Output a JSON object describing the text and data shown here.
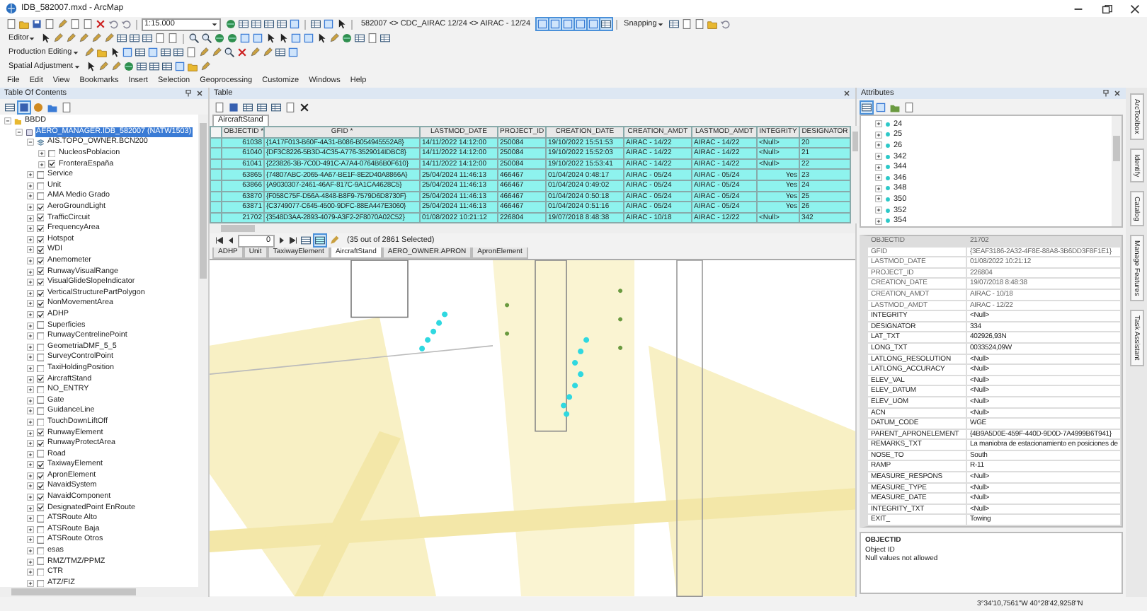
{
  "window": {
    "title": "IDB_582007.mxd - ArcMap"
  },
  "toolbars": {
    "scale": "1:15.000",
    "version_text": "582007 <> CDC_AIRAC 12/24 <> AIRAC - 12/24",
    "snapping": "Snapping",
    "editor": "Editor",
    "production_editing": "Production Editing",
    "spatial_adjustment": "Spatial Adjustment"
  },
  "menu": [
    "File",
    "Edit",
    "View",
    "Bookmarks",
    "Insert",
    "Selection",
    "Geoprocessing",
    "Customize",
    "Windows",
    "Help"
  ],
  "toc": {
    "title": "Table Of Contents",
    "tree": [
      {
        "label": "BBDD",
        "kind": "database",
        "expanded": true,
        "selected": false,
        "children": [
          {
            "label": "AERO_MANAGER.IDB_582007 (NATW1503)",
            "kind": "connection",
            "expanded": true,
            "selected": true,
            "children": [
              {
                "label": "AIS.TOPO_OWNER.BCN200",
                "kind": "group",
                "expanded": true,
                "selected": false,
                "children": [
                  {
                    "label": "NucleosPoblacion",
                    "kind": "layer",
                    "expanded": false,
                    "checked": false,
                    "selected": false
                  },
                  {
                    "label": "FronteraEspaña",
                    "kind": "layer",
                    "expanded": false,
                    "checked": true,
                    "selected": false
                  }
                ]
              },
              {
                "label": "Service",
                "kind": "layer",
                "expanded": false,
                "checked": false,
                "selected": false
              },
              {
                "label": "Unit",
                "kind": "layer",
                "expanded": false,
                "checked": false,
                "selected": false
              },
              {
                "label": "AMA Medio Grado",
                "kind": "layer",
                "expanded": false,
                "checked": false,
                "selected": false
              },
              {
                "label": "AeroGroundLight",
                "kind": "layer",
                "expanded": false,
                "checked": true,
                "selected": false
              },
              {
                "label": "TrafficCircuit",
                "kind": "layer",
                "expanded": false,
                "checked": true,
                "selected": false
              },
              {
                "label": "FrequencyArea",
                "kind": "layer",
                "expanded": false,
                "checked": true,
                "selected": false
              },
              {
                "label": "Hotspot",
                "kind": "layer",
                "expanded": false,
                "checked": true,
                "selected": false
              },
              {
                "label": "WDI",
                "kind": "layer",
                "expanded": false,
                "checked": true,
                "selected": false
              },
              {
                "label": "Anemometer",
                "kind": "layer",
                "expanded": false,
                "checked": true,
                "selected": false
              },
              {
                "label": "RunwayVisualRange",
                "kind": "layer",
                "expanded": false,
                "checked": true,
                "selected": false
              },
              {
                "label": "VisualGlideSlopeIndicator",
                "kind": "layer",
                "expanded": false,
                "checked": true,
                "selected": false
              },
              {
                "label": "VerticalStructurePartPolygon",
                "kind": "layer",
                "expanded": false,
                "checked": true,
                "selected": false
              },
              {
                "label": "NonMovementArea",
                "kind": "layer",
                "expanded": false,
                "checked": true,
                "selected": false
              },
              {
                "label": "ADHP",
                "kind": "layer",
                "expanded": false,
                "checked": true,
                "selected": false
              },
              {
                "label": "Superficies",
                "kind": "layer",
                "expanded": false,
                "checked": false,
                "selected": false
              },
              {
                "label": "RunwayCentrelinePoint",
                "kind": "layer",
                "expanded": false,
                "checked": false,
                "selected": false
              },
              {
                "label": "GeometriaDMF_5_5",
                "kind": "layer",
                "expanded": false,
                "checked": false,
                "selected": false
              },
              {
                "label": "SurveyControlPoint",
                "kind": "layer",
                "expanded": false,
                "checked": false,
                "selected": false
              },
              {
                "label": "TaxiHoldingPosition",
                "kind": "layer",
                "expanded": false,
                "checked": false,
                "selected": false
              },
              {
                "label": "AircraftStand",
                "kind": "layer",
                "expanded": false,
                "checked": true,
                "selected": false
              },
              {
                "label": "NO_ENTRY",
                "kind": "layer",
                "expanded": false,
                "checked": false,
                "selected": false
              },
              {
                "label": "Gate",
                "kind": "layer",
                "expanded": false,
                "checked": false,
                "selected": false
              },
              {
                "label": "GuidanceLine",
                "kind": "layer",
                "expanded": false,
                "checked": false,
                "selected": false
              },
              {
                "label": "TouchDownLiftOff",
                "kind": "layer",
                "expanded": false,
                "checked": false,
                "selected": false
              },
              {
                "label": "RunwayElement",
                "kind": "layer",
                "expanded": false,
                "checked": true,
                "selected": false
              },
              {
                "label": "RunwayProtectArea",
                "kind": "layer",
                "expanded": false,
                "checked": true,
                "selected": false
              },
              {
                "label": "Road",
                "kind": "layer",
                "expanded": false,
                "checked": false,
                "selected": false
              },
              {
                "label": "TaxiwayElement",
                "kind": "layer",
                "expanded": false,
                "checked": true,
                "selected": false
              },
              {
                "label": "ApronElement",
                "kind": "layer",
                "expanded": false,
                "checked": true,
                "selected": false
              },
              {
                "label": "NavaidSystem",
                "kind": "layer",
                "expanded": false,
                "checked": true,
                "selected": false
              },
              {
                "label": "NavaidComponent",
                "kind": "layer",
                "expanded": false,
                "checked": true,
                "selected": false
              },
              {
                "label": "DesignatedPoint EnRoute",
                "kind": "layer",
                "expanded": false,
                "checked": true,
                "selected": false
              },
              {
                "label": "ATSRoute Alto",
                "kind": "layer",
                "expanded": false,
                "checked": false,
                "selected": false
              },
              {
                "label": "ATSRoute Baja",
                "kind": "layer",
                "expanded": false,
                "checked": false,
                "selected": false
              },
              {
                "label": "ATSRoute Otros",
                "kind": "layer",
                "expanded": false,
                "checked": false,
                "selected": false
              },
              {
                "label": "esas",
                "kind": "layer",
                "expanded": false,
                "checked": false,
                "selected": false
              },
              {
                "label": "RMZ/TMZ/PPMZ",
                "kind": "layer",
                "expanded": false,
                "checked": false,
                "selected": false
              },
              {
                "label": "CTR",
                "kind": "layer",
                "expanded": false,
                "checked": false,
                "selected": false
              },
              {
                "label": "ATZ/FIZ",
                "kind": "layer",
                "expanded": false,
                "checked": false,
                "selected": false
              }
            ]
          }
        ]
      }
    ]
  },
  "table": {
    "title": "Table",
    "layer_tab": "AircraftStand",
    "columns": [
      "OBJECTID *",
      "GFID *",
      "LASTMOD_DATE",
      "PROJECT_ID",
      "CREATION_DATE",
      "CREATION_AMDT",
      "LASTMOD_AMDT",
      "INTEGRITY",
      "DESIGNATOR"
    ],
    "rows": [
      {
        "selected": true,
        "cells": [
          "61038",
          "{1A17F013-B60F-4A31-B086-B054945552A8}",
          "14/11/2022 14:12:00",
          "250084",
          "19/10/2022 15:51:53",
          "AIRAC - 14/22",
          "AIRAC - 14/22",
          "<Null>",
          "20"
        ]
      },
      {
        "selected": true,
        "cells": [
          "61040",
          "{DF3C8226-5B3D-4C35-A776-3529014IDBC8}",
          "14/11/2022 14:12:00",
          "250084",
          "19/10/2022 15:52:03",
          "AIRAC - 14/22",
          "AIRAC - 14/22",
          "<Null>",
          "21"
        ]
      },
      {
        "selected": true,
        "cells": [
          "61041",
          "{223826-3B-7C0D-491C-A7A4-0764B6B0F610}",
          "14/11/2022 14:12:00",
          "250084",
          "19/10/2022 15:53:41",
          "AIRAC - 14/22",
          "AIRAC - 14/22",
          "<Null>",
          "22"
        ]
      },
      {
        "selected": true,
        "cells": [
          "63865",
          "{74807ABC-2065-4A67-BE1F-8E2D40A8866A}",
          "25/04/2024 11:46:13",
          "466467",
          "01/04/2024 0:48:17",
          "AIRAC - 05/24",
          "AIRAC - 05/24",
          "Yes",
          "23"
        ]
      },
      {
        "selected": true,
        "cells": [
          "63866",
          "{A9030307-2461-46AF-817C-9A1CA4628C5}",
          "25/04/2024 11:46:13",
          "466467",
          "01/04/2024 0:49:02",
          "AIRAC - 05/24",
          "AIRAC - 05/24",
          "Yes",
          "24"
        ]
      },
      {
        "selected": true,
        "cells": [
          "63870",
          "{F058C75F-D56A-4848-B8F9-7579D6D8730F}",
          "25/04/2024 11:46:13",
          "466467",
          "01/04/2024 0:50:18",
          "AIRAC - 05/24",
          "AIRAC - 05/24",
          "Yes",
          "25"
        ]
      },
      {
        "selected": true,
        "cells": [
          "63871",
          "{C3749077-C645-4500-9DFC-88EA447E3060}",
          "25/04/2024 11:46:13",
          "466467",
          "01/04/2024 0:51:16",
          "AIRAC - 05/24",
          "AIRAC - 05/24",
          "Yes",
          "26"
        ]
      },
      {
        "selected": true,
        "cells": [
          "21702",
          "{3548D3AA-2893-4079-A3F2-2F8070A02C52}",
          "01/08/2022 10:21:12",
          "226804",
          "19/07/2018 8:48:38",
          "AIRAC - 10/18",
          "AIRAC - 12/22",
          "<Null>",
          "342"
        ]
      }
    ],
    "record": "0",
    "selection_text": "(35 out of 2861 Selected)",
    "tabs": [
      {
        "label": "ADHP",
        "selected": false
      },
      {
        "label": "Unit",
        "selected": false
      },
      {
        "label": "TaxiwayElement",
        "selected": false
      },
      {
        "label": "AircraftStand",
        "selected": true
      },
      {
        "label": "AERO_OWNER.APRON",
        "selected": false
      },
      {
        "label": "ApronElement",
        "selected": false
      }
    ]
  },
  "attributes": {
    "title": "Attributes",
    "features": [
      {
        "label": "24",
        "expanded": false
      },
      {
        "label": "25",
        "expanded": false
      },
      {
        "label": "26",
        "expanded": false
      },
      {
        "label": "342",
        "expanded": false
      },
      {
        "label": "344",
        "expanded": false
      },
      {
        "label": "346",
        "expanded": false
      },
      {
        "label": "348",
        "expanded": false
      },
      {
        "label": "350",
        "expanded": false
      },
      {
        "label": "352",
        "expanded": false
      },
      {
        "label": "354",
        "expanded": false
      }
    ],
    "fields": [
      {
        "name": "OBJECTID",
        "value": "21702",
        "disabled": true
      },
      {
        "name": "GFID",
        "value": "{3EAF3186-2A32-4F8E-88A8-3B6DD3F8F1E1}",
        "disabled": true
      },
      {
        "name": "LASTMOD_DATE",
        "value": "01/08/2022 10:21:12",
        "disabled": true
      },
      {
        "name": "PROJECT_ID",
        "value": "226804",
        "disabled": true
      },
      {
        "name": "CREATION_DATE",
        "value": "19/07/2018 8:48:38",
        "disabled": true
      },
      {
        "name": "CREATION_AMDT",
        "value": "AIRAC - 10/18",
        "disabled": true
      },
      {
        "name": "LASTMOD_AMDT",
        "value": "AIRAC - 12/22",
        "disabled": true
      },
      {
        "name": "INTEGRITY",
        "value": "<Null>",
        "disabled": false
      },
      {
        "name": "DESIGNATOR",
        "value": "334",
        "disabled": false
      },
      {
        "name": "LAT_TXT",
        "value": "402926,93N",
        "disabled": false
      },
      {
        "name": "LONG_TXT",
        "value": "0033524,09W",
        "disabled": false
      },
      {
        "name": "LATLONG_RESOLUTION",
        "value": "<Null>",
        "disabled": false
      },
      {
        "name": "LATLONG_ACCURACY",
        "value": "<Null>",
        "disabled": false
      },
      {
        "name": "ELEV_VAL",
        "value": "<Null>",
        "disabled": false
      },
      {
        "name": "ELEV_DATUM",
        "value": "<Null>",
        "disabled": false
      },
      {
        "name": "ELEV_UOM",
        "value": "<Null>",
        "disabled": false
      },
      {
        "name": "ACN",
        "value": "<Null>",
        "disabled": false
      },
      {
        "name": "DATUM_CODE",
        "value": "WGE",
        "disabled": false
      },
      {
        "name": "PARENT_APRONELEMENT",
        "value": "{4B9A5D0E-459F-440D-9D0D-7A4999B6T941}",
        "disabled": false
      },
      {
        "name": "REMARKS_TXT",
        "value": "La maniobra de estacionamiento en posiciones de",
        "disabled": false
      },
      {
        "name": "NOSE_TO",
        "value": "South",
        "disabled": false
      },
      {
        "name": "RAMP",
        "value": "R-11",
        "disabled": false
      },
      {
        "name": "MEASURE_RESPONS",
        "value": "<Null>",
        "disabled": false
      },
      {
        "name": "MEASURE_TYPE",
        "value": "<Null>",
        "disabled": false
      },
      {
        "name": "MEASURE_DATE",
        "value": "<Null>",
        "disabled": false
      },
      {
        "name": "INTEGRITY_TXT",
        "value": "<Null>",
        "disabled": false
      },
      {
        "name": "EXIT_",
        "value": "Towing",
        "disabled": false
      }
    ],
    "description": {
      "field": "OBJECTID",
      "alias": "Object ID",
      "note": "Null values not allowed"
    }
  },
  "side_tabs": [
    "ArcToolbox",
    "Identify",
    "Catalog",
    "Manage Features",
    "Task Assistant"
  ],
  "status_bar": {
    "coordinates": "3°34'10,7561\"W  40°28'42,9258\"N"
  }
}
